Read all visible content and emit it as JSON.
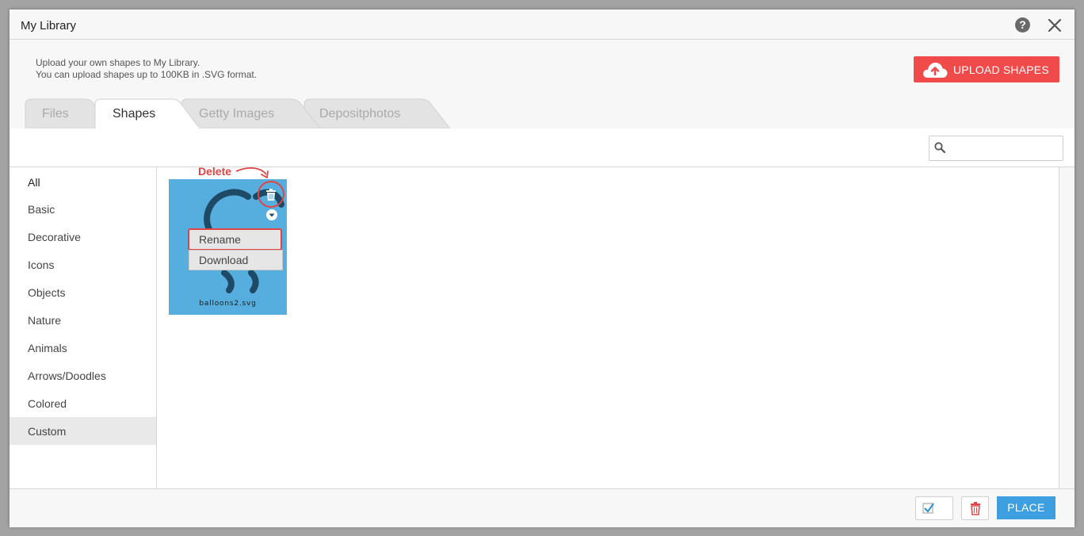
{
  "window": {
    "title": "My Library",
    "help_label": "?"
  },
  "info": {
    "line1": "Upload your own shapes to My Library.",
    "line2": "You can upload shapes up to 100KB in .SVG format."
  },
  "upload_button": {
    "label": "UPLOAD SHAPES"
  },
  "tabs": [
    {
      "label": "Files",
      "active": false
    },
    {
      "label": "Shapes",
      "active": true
    },
    {
      "label": "Getty Images",
      "active": false
    },
    {
      "label": "Depositphotos",
      "active": false
    }
  ],
  "search": {
    "placeholder": "",
    "value": ""
  },
  "categories": [
    {
      "label": "All"
    },
    {
      "label": "Basic"
    },
    {
      "label": "Decorative"
    },
    {
      "label": "Icons"
    },
    {
      "label": "Objects"
    },
    {
      "label": "Nature"
    },
    {
      "label": "Animals"
    },
    {
      "label": "Arrows/Doodles"
    },
    {
      "label": "Colored"
    },
    {
      "label": "Custom",
      "selected": true
    }
  ],
  "tile": {
    "filename": "balloons2.svg",
    "menu": {
      "rename": "Rename",
      "download": "Download"
    }
  },
  "annotation": {
    "text": "Delete"
  },
  "footer": {
    "place_label": "PLACE"
  },
  "colors": {
    "accent_red": "#f04a4a",
    "accent_blue": "#3d9fe0",
    "tile_blue": "#56aedf",
    "annotation_red": "#e04444"
  }
}
